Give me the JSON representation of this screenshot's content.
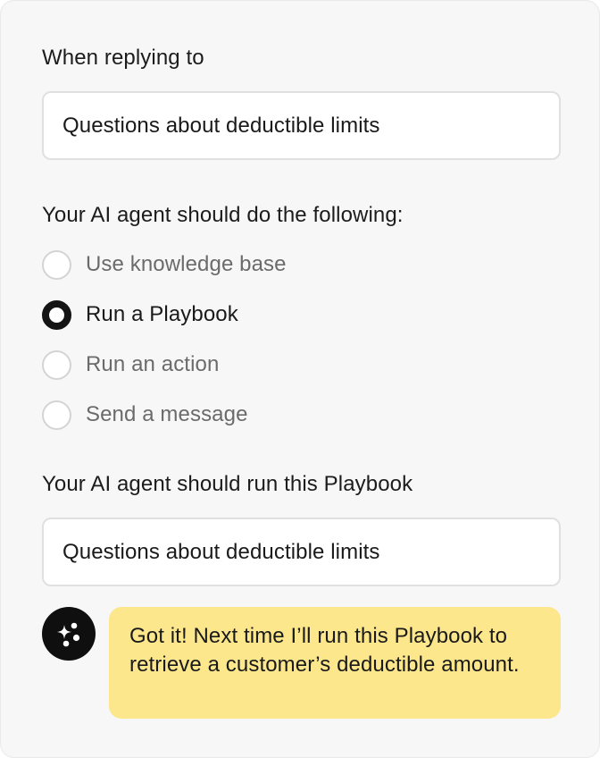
{
  "form": {
    "reply_label": "When replying to",
    "reply_value": "Questions about deductible limits",
    "action_label": "Your AI agent should do the following:",
    "options": [
      {
        "label": "Use knowledge base",
        "selected": false
      },
      {
        "label": "Run a Playbook",
        "selected": true
      },
      {
        "label": "Run an action",
        "selected": false
      },
      {
        "label": "Send a message",
        "selected": false
      }
    ],
    "playbook_label": "Your AI agent should run this Playbook",
    "playbook_value": "Questions about deductible limits"
  },
  "agent": {
    "icon": "sparkles-icon",
    "message": "Got it! Next time I’ll run this Playbook to retrieve a customer’s deductible amount."
  },
  "colors": {
    "card_bg": "#f7f7f7",
    "bubble_bg": "#fce78d",
    "selected_radio": "#141414",
    "avatar_bg": "#0f0f0f"
  }
}
